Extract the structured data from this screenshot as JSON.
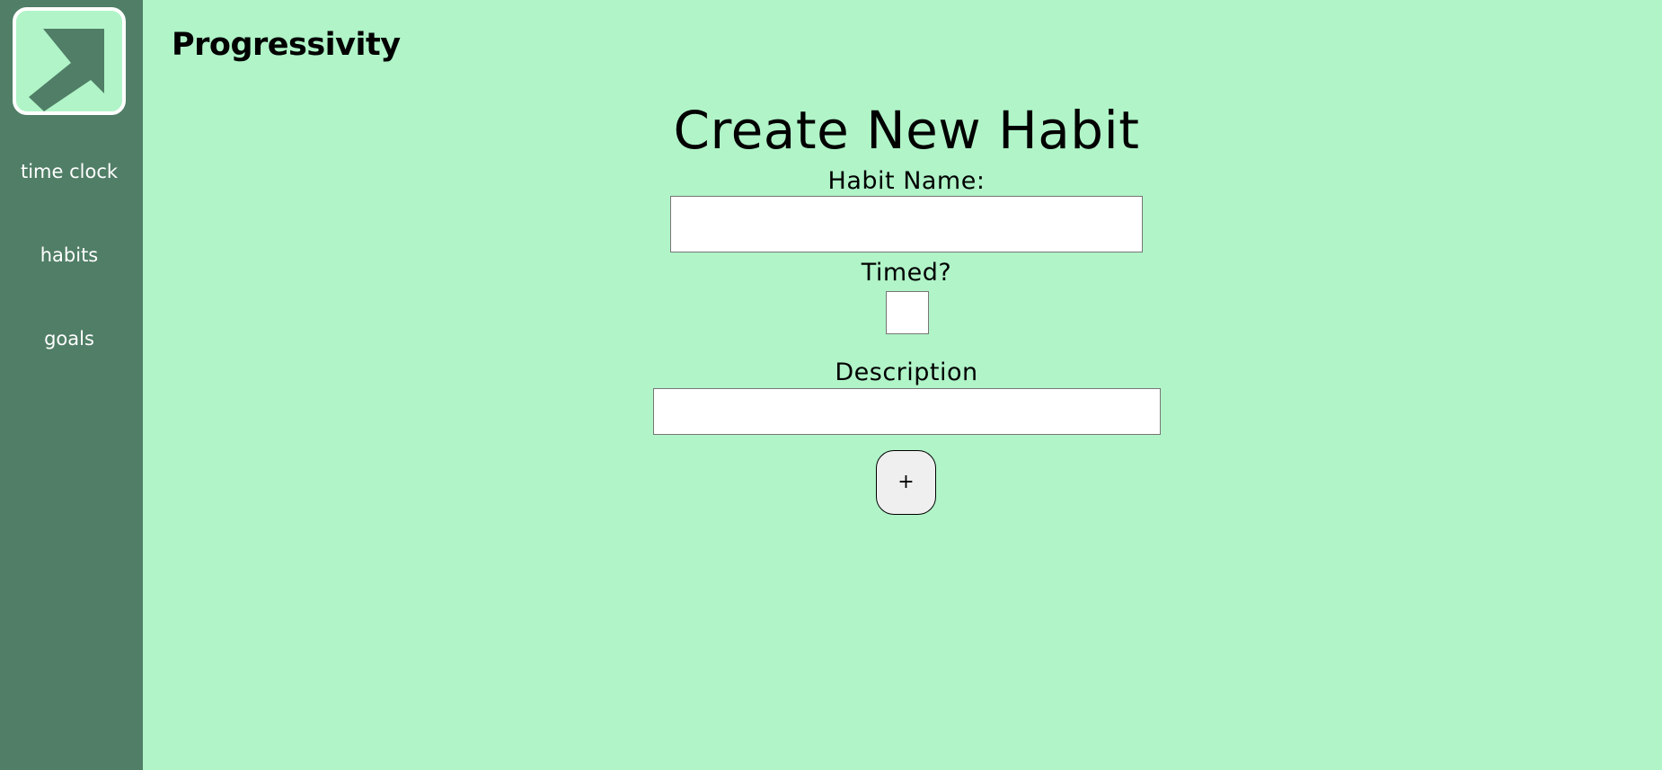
{
  "app": {
    "brand": "Progressivity"
  },
  "sidebar": {
    "logo_icon": "arrow-up-right-icon",
    "items": [
      {
        "label": "time clock"
      },
      {
        "label": "habits"
      },
      {
        "label": "goals"
      }
    ]
  },
  "form": {
    "title": "Create New Habit",
    "habit_name_label": "Habit Name:",
    "habit_name_value": "",
    "habit_name_placeholder": "",
    "timed_label": "Timed?",
    "timed_checked": false,
    "description_label": "Description",
    "description_value": "",
    "description_placeholder": "",
    "add_button_label": "+"
  },
  "colors": {
    "background": "#b0f4c8",
    "sidebar": "#507e66",
    "logo_border": "#ffffff",
    "text": "#000000"
  }
}
